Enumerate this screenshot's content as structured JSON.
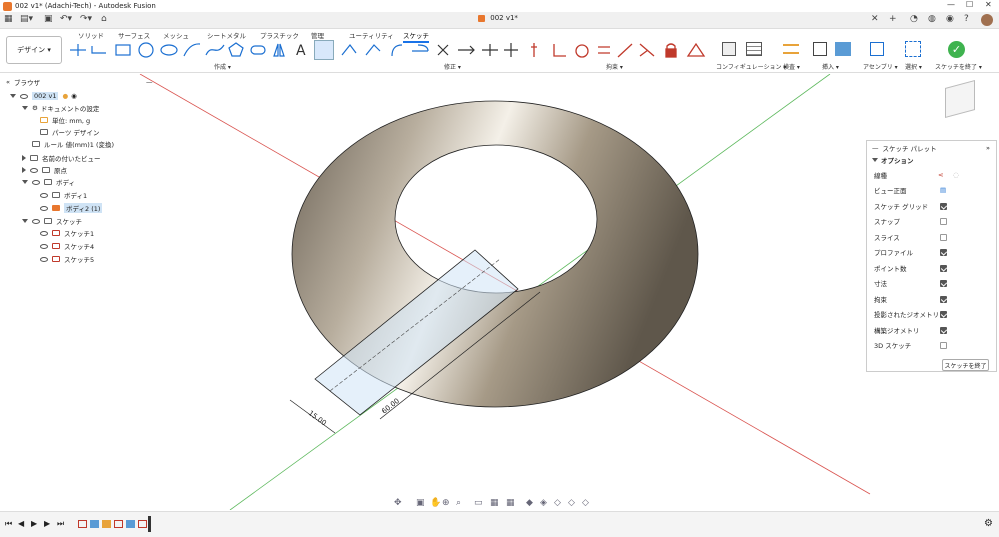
{
  "window": {
    "title": "002 v1* (Adachi-Tech) - Autodesk Fusion",
    "doc_tab": "002 v1*"
  },
  "ribbon": {
    "workspace": "デザイン",
    "tabs": [
      "ソリッド",
      "サーフェス",
      "メッシュ",
      "シートメタル",
      "プラスチック",
      "管理",
      "ユーティリティ",
      "スケッチ"
    ],
    "active_tab": "スケッチ",
    "groups": [
      "作成 ▾",
      "修正 ▾",
      "拘束 ▾",
      "コンフィギュレーション ▾",
      "検査 ▾",
      "挿入 ▾",
      "アセンブリ ▾",
      "選択 ▾",
      "スケッチを終了 ▾"
    ],
    "accent": "#1a73e8"
  },
  "browser": {
    "title": "ブラウザ",
    "items": [
      {
        "label": "002 v1"
      },
      {
        "label": "ドキュメントの設定"
      },
      {
        "label": "単位: mm, g"
      },
      {
        "label": "パーツ デザイン"
      },
      {
        "label": "ルール 値(mm)1 (変換)"
      },
      {
        "label": "名前の付いたビュー"
      },
      {
        "label": "原点"
      },
      {
        "label": "ボディ"
      },
      {
        "label": "ボディ1"
      },
      {
        "label": "ボディ2 (1)"
      },
      {
        "label": "スケッチ"
      },
      {
        "label": "スケッチ1"
      },
      {
        "label": "スケッチ4"
      },
      {
        "label": "スケッチ5"
      }
    ]
  },
  "palette": {
    "title": "スケッチ パレット",
    "section": "オプション",
    "rows": [
      {
        "label": "線種"
      },
      {
        "label": "ビュー正面"
      },
      {
        "label": "スケッチ グリッド",
        "checked": true
      },
      {
        "label": "スナップ",
        "checked": false
      },
      {
        "label": "スライス",
        "checked": false
      },
      {
        "label": "プロファイル",
        "checked": true
      },
      {
        "label": "ポイント数",
        "checked": true
      },
      {
        "label": "寸法",
        "checked": true
      },
      {
        "label": "拘束",
        "checked": true
      },
      {
        "label": "投影されたジオメトリ",
        "checked": true
      },
      {
        "label": "構築ジオメトリ",
        "checked": true
      },
      {
        "label": "3D スケッチ",
        "checked": false
      }
    ],
    "finish_button": "スケッチを終了"
  },
  "viewport": {
    "dims": [
      "15.00",
      "60.00"
    ],
    "axis_red": "#d9534f",
    "axis_green": "#5cb85c",
    "profile_fill": "#cfe3f5"
  }
}
